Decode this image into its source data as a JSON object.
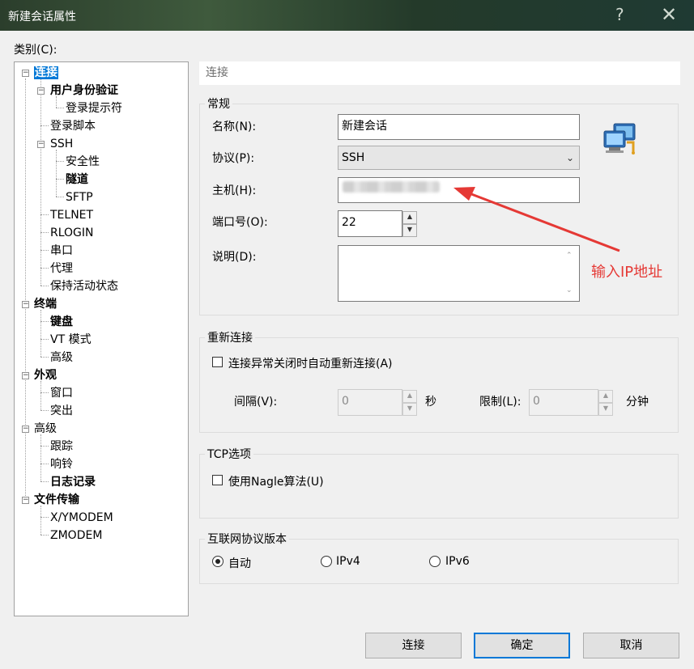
{
  "window": {
    "title": "新建会话属性",
    "help_glyph": "?",
    "close_glyph": "✕"
  },
  "category_label": "类别(C):",
  "tree": {
    "lian_jie": "连接",
    "user_auth": "用户身份验证",
    "login_prompt": "登录提示符",
    "login_script": "登录脚本",
    "ssh": "SSH",
    "security": "安全性",
    "tunnel": "隧道",
    "sftp": "SFTP",
    "telnet": "TELNET",
    "rlogin": "RLOGIN",
    "serial": "串口",
    "proxy": "代理",
    "keepalive": "保持活动状态",
    "terminal": "终端",
    "keyboard": "键盘",
    "vt_mode": "VT 模式",
    "term_advanced": "高级",
    "appearance": "外观",
    "window": "窗口",
    "highlight": "突出",
    "advanced": "高级",
    "trace": "跟踪",
    "bell": "响铃",
    "logging": "日志记录",
    "file_transfer": "文件传输",
    "xymodem": "X/YMODEM",
    "zmodem": "ZMODEM"
  },
  "panel": {
    "header": "连接",
    "general": {
      "legend": "常规",
      "name_label": "名称(N):",
      "name_value": "新建会话",
      "protocol_label": "协议(P):",
      "protocol_value": "SSH",
      "host_label": "主机(H):",
      "port_label": "端口号(O):",
      "port_value": "22",
      "desc_label": "说明(D):"
    },
    "reconnect": {
      "legend": "重新连接",
      "auto_label": "连接异常关闭时自动重新连接(A)",
      "interval_label": "间隔(V):",
      "interval_value": "0",
      "interval_unit": "秒",
      "limit_label": "限制(L):",
      "limit_value": "0",
      "limit_unit": "分钟"
    },
    "tcp": {
      "legend": "TCP选项",
      "nagle_label": "使用Nagle算法(U)"
    },
    "ipver": {
      "legend": "互联网协议版本",
      "auto": "自动",
      "ipv4": "IPv4",
      "ipv6": "IPv6",
      "selected": "自动"
    }
  },
  "annotation": "输入IP地址",
  "buttons": {
    "connect": "连接",
    "ok": "确定",
    "cancel": "取消"
  }
}
